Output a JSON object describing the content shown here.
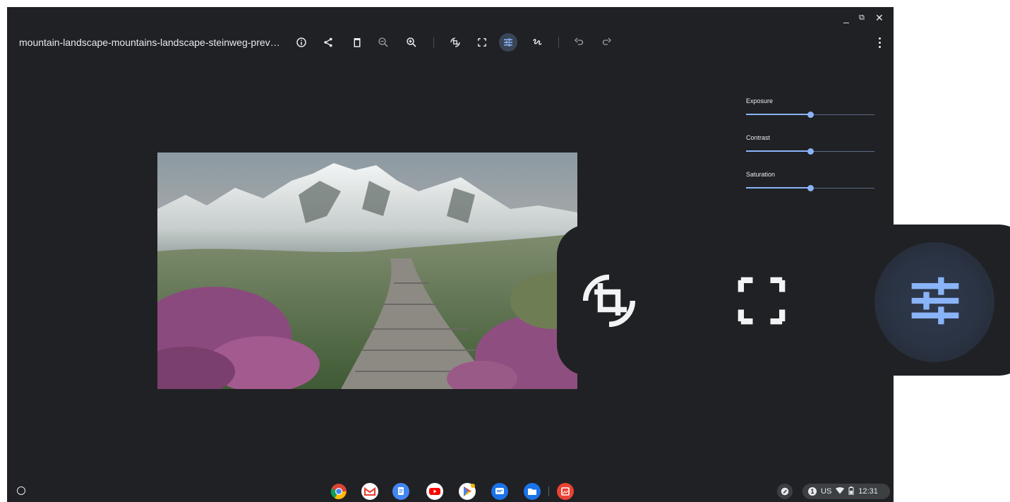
{
  "window": {
    "title": "mountain-landscape-mountains-landscape-steinweg-prev…",
    "controls": {
      "minimize": "_",
      "maximize": "⧉",
      "close": "✕"
    }
  },
  "toolbar": {
    "icons": [
      "info-icon",
      "share-icon",
      "delete-icon",
      "zoom-out-icon",
      "zoom-in-icon",
      "rotate-crop-icon",
      "rescale-icon",
      "adjust-icon",
      "annotate-icon",
      "undo-icon",
      "redo-icon"
    ],
    "active": "adjust-icon",
    "more": "more-options-icon"
  },
  "adjustments": {
    "exposure": {
      "label": "Exposure",
      "value": 0.5
    },
    "contrast": {
      "label": "Contrast",
      "value": 0.5
    },
    "saturation": {
      "label": "Saturation",
      "value": 0.5
    }
  },
  "shelf": {
    "apps": [
      "chrome-icon",
      "gmail-icon",
      "docs-icon",
      "youtube-icon",
      "play-store-icon",
      "messages-icon",
      "files-icon",
      "gallery-icon"
    ],
    "tray": {
      "notification_count": "1",
      "ime": "US",
      "time": "12:31"
    }
  },
  "colors": {
    "background": "#202124",
    "accent": "#8ab4f8",
    "active_bg": "#394457"
  }
}
